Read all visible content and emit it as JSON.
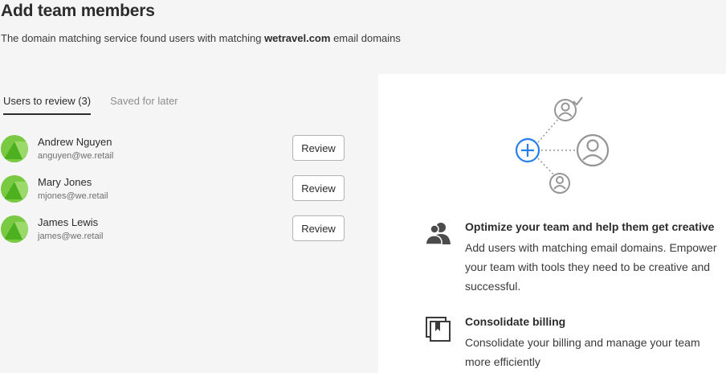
{
  "header": {
    "title": "Add team members",
    "subtitle_prefix": "The domain matching service found users with matching",
    "domain": "wetravel.com",
    "subtitle_suffix": "email domains"
  },
  "tabs": [
    {
      "label": "Users to review (3)",
      "active": true
    },
    {
      "label": "Saved for later",
      "active": false
    }
  ],
  "users": [
    {
      "name": "Andrew Nguyen",
      "email": "anguyen@we.retail",
      "action": "Review"
    },
    {
      "name": "Mary Jones",
      "email": "mjones@we.retail",
      "action": "Review"
    },
    {
      "name": "James Lewis",
      "email": "james@we.retail",
      "action": "Review"
    }
  ],
  "features": [
    {
      "icon": "users-icon",
      "title": "Optimize your team and help them get creative",
      "text": "Add users with matching email domains. Empower your team with tools they need to be creative and successful."
    },
    {
      "icon": "billing-icon",
      "title": "Consolidate billing",
      "text": "Consolidate your billing and manage your team more efficiently"
    }
  ],
  "colors": {
    "accent": "#2680eb",
    "avatar_green": "#7ac943",
    "icon_gray": "#959595"
  }
}
